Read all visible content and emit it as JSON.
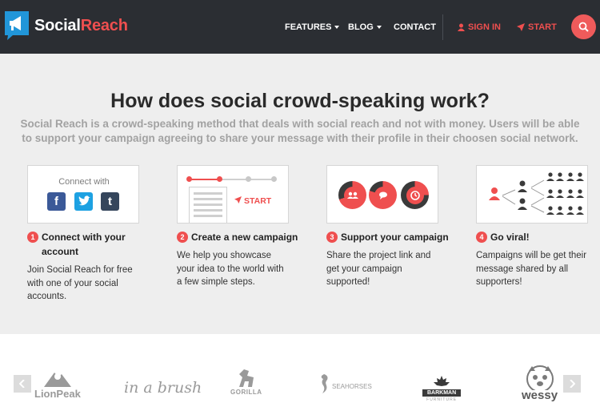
{
  "brand": {
    "name_part1": "Social",
    "name_part2": "Reach"
  },
  "nav": {
    "features": "FEATURES",
    "blog": "BLOG",
    "contact": "CONTACT",
    "sign_in": "SIGN IN",
    "start": "START"
  },
  "how": {
    "title": "How does social crowd-speaking work?",
    "subtitle": "Social Reach is a crowd-speaking method that deals with social reach and not with money. Users will be able to support your campaign agreeing to share your message with their profile in their choosen social network.",
    "steps": [
      {
        "number": "1",
        "title": "Connect with your account",
        "desc": "Join Social Reach for free with one of your social accounts.",
        "card_text": "Connect with"
      },
      {
        "number": "2",
        "title": "Create a new campaign",
        "desc": "We help you showcase your idea to the world with a few simple steps.",
        "card_text": "START"
      },
      {
        "number": "3",
        "title": "Support your campaign",
        "desc": "Share the project link and get your campaign supported!"
      },
      {
        "number": "4",
        "title": "Go viral!",
        "desc": "Campaigns will be get their message shared by all supporters!"
      }
    ]
  },
  "logos": {
    "items": [
      "LionPeak",
      "in a brush",
      "GORILLA",
      "SEAHORSES",
      "BARKMAN",
      "FURNITURE",
      "wessy"
    ]
  },
  "colors": {
    "accent": "#ef4f4f",
    "navbar": "#2b2e33",
    "section_bg": "#eeeeee"
  }
}
